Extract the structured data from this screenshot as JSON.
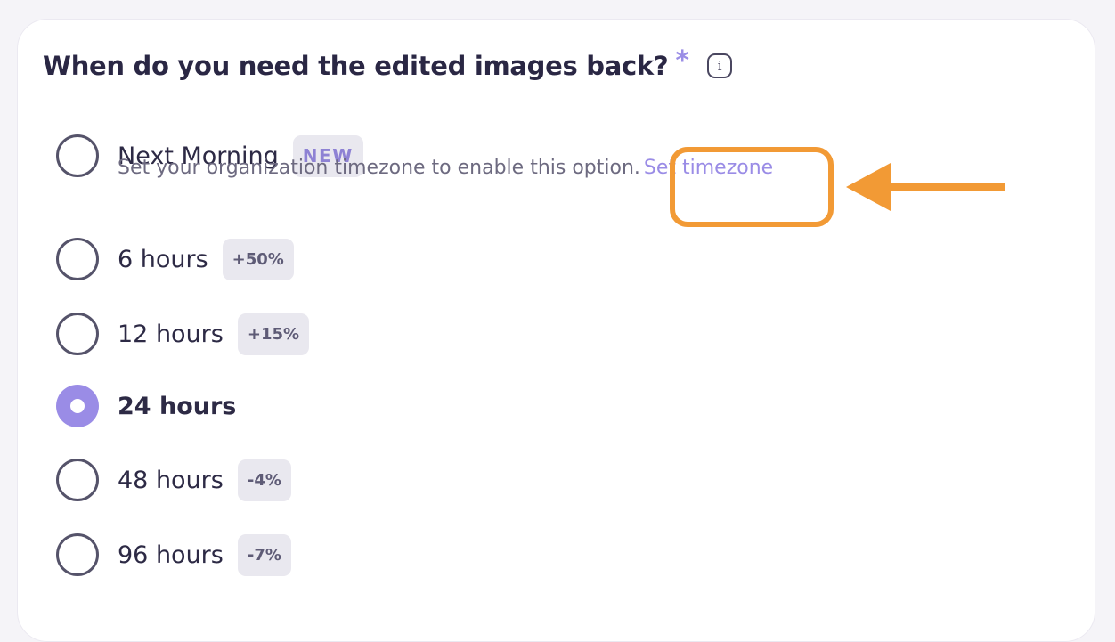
{
  "question": {
    "text": "When do you need the edited images back?",
    "required_marker": "*",
    "info_icon": "info-icon",
    "info_glyph": "i"
  },
  "options": [
    {
      "label": "Next Morning",
      "badge": "NEW",
      "selected": false,
      "note": "Set your organization timezone to enable this option.",
      "note_link": "Set timezone"
    },
    {
      "label": "6 hours",
      "badge": "+50%",
      "selected": false
    },
    {
      "label": "12 hours",
      "badge": "+15%",
      "selected": false
    },
    {
      "label": "24 hours",
      "badge": "",
      "selected": true
    },
    {
      "label": "48 hours",
      "badge": "-4%",
      "selected": false
    },
    {
      "label": "96 hours",
      "badge": "-7%",
      "selected": false
    }
  ],
  "annotation": {
    "highlight_color": "#f29a35",
    "arrow_icon": "left-arrow-icon"
  },
  "colors": {
    "accent": "#9a8ce6",
    "text": "#2a2744",
    "badge_bg": "#e9e8ef"
  }
}
